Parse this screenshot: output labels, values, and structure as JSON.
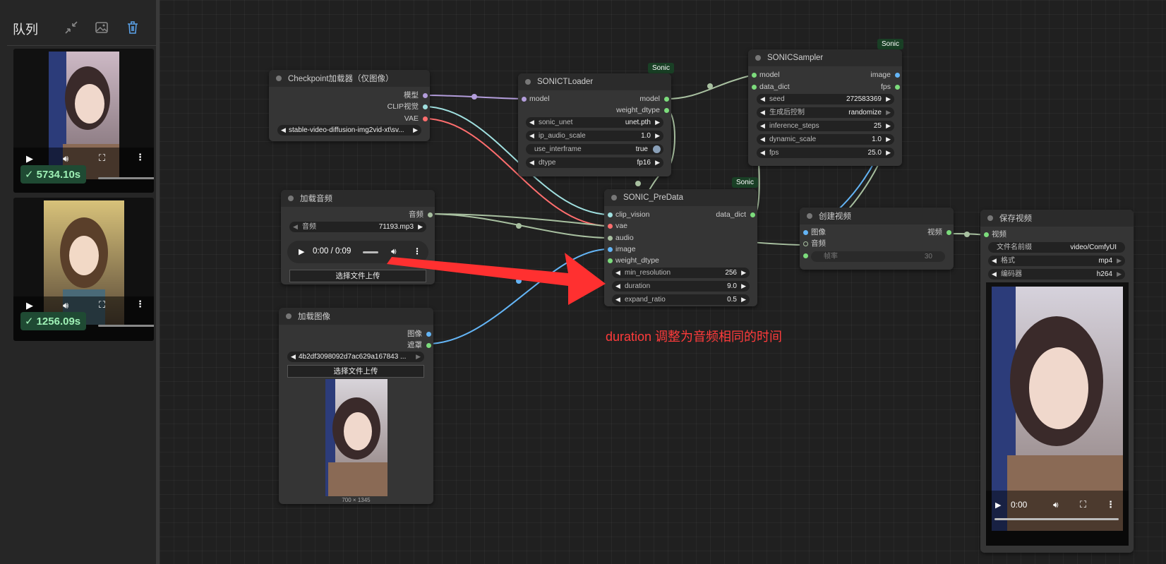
{
  "queue": {
    "title": "队列",
    "icons": [
      "collapse-icon",
      "image-icon",
      "trash-icon"
    ],
    "items": [
      {
        "time": "5734.10s"
      },
      {
        "time": "1256.09s"
      }
    ]
  },
  "nodes": {
    "checkpoint": {
      "title": "Checkpoint加载器（仅图像）",
      "outputs": [
        "模型",
        "CLIP视觉",
        "VAE"
      ],
      "ckpt": "stable-video-diffusion-img2vid-xt\\sv..."
    },
    "sonictloader": {
      "title": "SONICTLoader",
      "badge": "Sonic",
      "input": "model",
      "outputs": [
        "model",
        "weight_dtype"
      ],
      "w1_label": "sonic_unet",
      "w1_value": "unet.pth",
      "w2_label": "ip_audio_scale",
      "w2_value": "1.0",
      "w3_label": "use_interframe",
      "w3_value": "true",
      "w4_label": "dtype",
      "w4_value": "fp16"
    },
    "sonicsampler": {
      "title": "SONICSampler",
      "badge": "Sonic",
      "inputs": [
        "model",
        "data_dict"
      ],
      "outputs": [
        "image",
        "fps"
      ],
      "w1_label": "seed",
      "w1_value": "272583369",
      "w2_label": "生成后控制",
      "w2_value": "randomize",
      "w3_label": "inference_steps",
      "w3_value": "25",
      "w4_label": "dynamic_scale",
      "w4_value": "1.0",
      "w5_label": "fps",
      "w5_value": "25.0"
    },
    "loadaudio": {
      "title": "加载音频",
      "output": "音频",
      "w_label": "音频",
      "w_value": "71193.mp3",
      "player_time": "0:00 / 0:09",
      "upload": "选择文件上传"
    },
    "predata": {
      "title": "SONIC_PreData",
      "badge": "Sonic",
      "inputs": [
        "clip_vision",
        "vae",
        "audio",
        "image",
        "weight_dtype"
      ],
      "output": "data_dict",
      "w1_label": "min_resolution",
      "w1_value": "256",
      "w2_label": "duration",
      "w2_value": "9.0",
      "w3_label": "expand_ratio",
      "w3_value": "0.5"
    },
    "createvideo": {
      "title": "创建视频",
      "inputs": [
        "图像",
        "音频"
      ],
      "output": "视频",
      "w_label": "帧率",
      "w_value": "30"
    },
    "loadimage": {
      "title": "加载图像",
      "outputs": [
        "图像",
        "遮罩"
      ],
      "w_value": "4b2df3098092d7ac629a167843 ...",
      "upload": "选择文件上传",
      "dims": "700 × 1345"
    },
    "savevideo": {
      "title": "保存视频",
      "input": "视频",
      "w1_label": "文件名前缀",
      "w1_value": "video/ComfyUI",
      "w2_label": "格式",
      "w2_value": "mp4",
      "w3_label": "编码器",
      "w3_value": "h264",
      "player_time": "0:00"
    }
  },
  "annotation": "duration 调整为音频相同的时间",
  "colors": {
    "model": "#b39ddb",
    "clip": "#a0e0e0",
    "vae": "#ff6e6e",
    "audio": "#a8c0a0",
    "image": "#64b5f6",
    "green": "#7cdc7c",
    "arrow": "#ff3030",
    "badge_bg": "#1f4a33",
    "badge_text": "#9ef0b5"
  }
}
